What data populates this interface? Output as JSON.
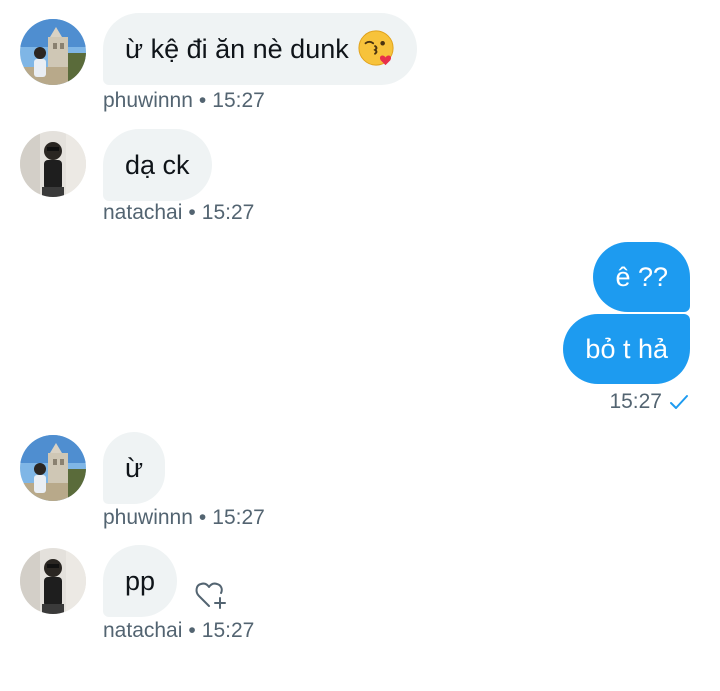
{
  "messages": [
    {
      "direction": "in",
      "sender": "phuwinnn",
      "text": "ừ kệ đi ăn nè dunk",
      "emoji": "kissing-face-with-heart-emoji",
      "time": "15:27",
      "separator": "•"
    },
    {
      "direction": "in",
      "sender": "natachai",
      "text": "dạ ck",
      "time": "15:27",
      "separator": "•"
    },
    {
      "direction": "out",
      "text": "ê ??"
    },
    {
      "direction": "out",
      "text": "bỏ t hả",
      "time": "15:27",
      "status": "seen-check-icon"
    },
    {
      "direction": "in",
      "sender": "phuwinnn",
      "text": "ừ",
      "time": "15:27",
      "separator": "•"
    },
    {
      "direction": "in",
      "sender": "natachai",
      "text": "pp",
      "time": "15:27",
      "separator": "•",
      "reaction_action": "add-reaction-heart-icon"
    }
  ],
  "colors": {
    "outgoing_bubble": "#1d9bf0",
    "incoming_bubble": "#eff3f4",
    "meta_text": "#536471",
    "check": "#1d9bf0"
  }
}
